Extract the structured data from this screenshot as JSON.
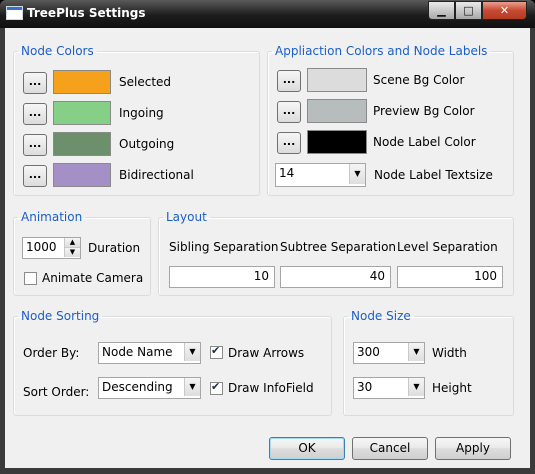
{
  "window": {
    "title": "TreePlus Settings",
    "min_glyph": "▁",
    "max_glyph": "□",
    "close_glyph": "✕"
  },
  "node_colors": {
    "legend": "Node Colors",
    "items": [
      {
        "label": "Selected",
        "color": "#f5a11c"
      },
      {
        "label": "Ingoing",
        "color": "#86cf86"
      },
      {
        "label": "Outgoing",
        "color": "#6b906b"
      },
      {
        "label": "Bidirectional",
        "color": "#a490c6"
      }
    ]
  },
  "app_colors": {
    "legend": "Appliaction Colors and Node Labels",
    "items": [
      {
        "label": "Scene Bg Color",
        "color": "#dcdcdc"
      },
      {
        "label": "Preview Bg Color",
        "color": "#b7bcbc"
      },
      {
        "label": "Node Label Color",
        "color": "#000000"
      }
    ],
    "textsize_value": "14",
    "textsize_label": "Node Label Textsize"
  },
  "dots_label": "...",
  "animation": {
    "legend": "Animation",
    "duration_value": "1000",
    "duration_label": "Duration",
    "animate_camera_label": "Animate Camera",
    "animate_camera_checked": false
  },
  "layout": {
    "legend": "Layout",
    "columns": [
      {
        "label": "Sibling Separation",
        "value": "10"
      },
      {
        "label": "Subtree Separation",
        "value": "40"
      },
      {
        "label": "Level Separation",
        "value": "100"
      }
    ]
  },
  "node_sorting": {
    "legend": "Node Sorting",
    "order_by_label": "Order By:",
    "order_by_value": "Node Name",
    "sort_order_label": "Sort Order:",
    "sort_order_value": "Descending",
    "draw_arrows_label": "Draw Arrows",
    "draw_arrows_checked": true,
    "draw_infofield_label": "Draw InfoField",
    "draw_infofield_checked": true
  },
  "node_size": {
    "legend": "Node Size",
    "width_value": "300",
    "width_label": "Width",
    "height_value": "30",
    "height_label": "Height"
  },
  "buttons": {
    "ok": "OK",
    "cancel": "Cancel",
    "apply": "Apply"
  },
  "combo_arrow": "▼",
  "spin_up": "▲",
  "spin_down": "▼"
}
